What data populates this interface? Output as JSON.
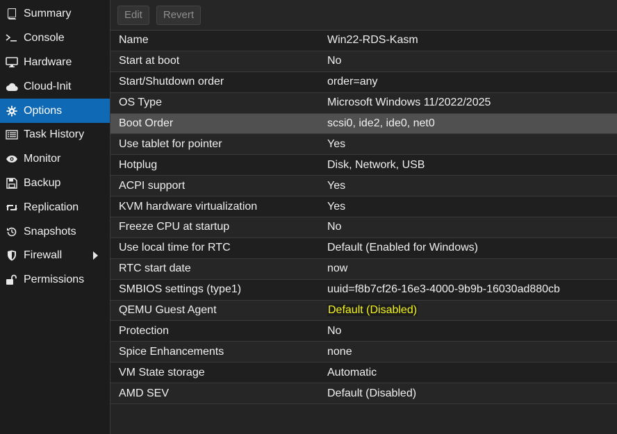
{
  "sidebar": {
    "items": [
      {
        "label": "Summary",
        "icon": "book-icon"
      },
      {
        "label": "Console",
        "icon": "terminal-icon"
      },
      {
        "label": "Hardware",
        "icon": "monitor-icon"
      },
      {
        "label": "Cloud-Init",
        "icon": "cloud-icon"
      },
      {
        "label": "Options",
        "icon": "gear-icon",
        "active": true
      },
      {
        "label": "Task History",
        "icon": "list-icon"
      },
      {
        "label": "Monitor",
        "icon": "eye-icon"
      },
      {
        "label": "Backup",
        "icon": "floppy-icon"
      },
      {
        "label": "Replication",
        "icon": "retweet-icon"
      },
      {
        "label": "Snapshots",
        "icon": "history-icon"
      },
      {
        "label": "Firewall",
        "icon": "shield-icon",
        "has_submenu": true
      },
      {
        "label": "Permissions",
        "icon": "unlock-icon"
      }
    ]
  },
  "toolbar": {
    "edit_label": "Edit",
    "revert_label": "Revert"
  },
  "options": {
    "rows": [
      {
        "name": "Name",
        "value": "Win22-RDS-Kasm"
      },
      {
        "name": "Start at boot",
        "value": "No"
      },
      {
        "name": "Start/Shutdown order",
        "value": "order=any"
      },
      {
        "name": "OS Type",
        "value": "Microsoft Windows 11/2022/2025"
      },
      {
        "name": "Boot Order",
        "value": "scsi0, ide2, ide0, net0",
        "selected": true
      },
      {
        "name": "Use tablet for pointer",
        "value": "Yes"
      },
      {
        "name": "Hotplug",
        "value": "Disk, Network, USB"
      },
      {
        "name": "ACPI support",
        "value": "Yes"
      },
      {
        "name": "KVM hardware virtualization",
        "value": "Yes"
      },
      {
        "name": "Freeze CPU at startup",
        "value": "No"
      },
      {
        "name": "Use local time for RTC",
        "value": "Default (Enabled for Windows)"
      },
      {
        "name": "RTC start date",
        "value": "now"
      },
      {
        "name": "SMBIOS settings (type1)",
        "value": "uuid=f8b7cf26-16e3-4000-9b9b-16030ad880cb"
      },
      {
        "name": "QEMU Guest Agent",
        "value": "Default (Disabled)",
        "highlight": true
      },
      {
        "name": "Protection",
        "value": "No"
      },
      {
        "name": "Spice Enhancements",
        "value": "none"
      },
      {
        "name": "VM State storage",
        "value": "Automatic"
      },
      {
        "name": "AMD SEV",
        "value": "Default (Disabled)"
      }
    ]
  },
  "colors": {
    "active_nav": "#0f69b4",
    "highlight_text": "#f5f51a"
  }
}
